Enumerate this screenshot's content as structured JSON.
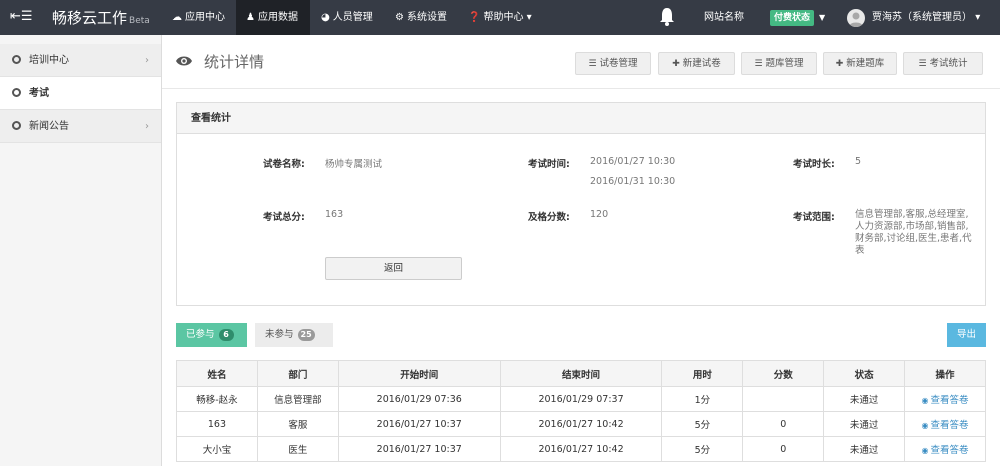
{
  "navbar": {
    "brand": "畅移云工作",
    "beta": "Beta",
    "items": [
      {
        "label": "应用中心",
        "icon": "cloud-icon"
      },
      {
        "label": "应用数据",
        "icon": "users-icon",
        "active": true
      },
      {
        "label": "人员管理",
        "icon": "dashboard-icon"
      },
      {
        "label": "系统设置",
        "icon": "gears-icon"
      },
      {
        "label": "帮助中心",
        "icon": "question-icon"
      }
    ],
    "site_name": "网站名称",
    "pay_status": "付费状态",
    "user": "贾海苏（系统管理员）",
    "accent": "#44b983"
  },
  "sidebar": {
    "items": [
      {
        "label": "培训中心"
      },
      {
        "label": "考试"
      },
      {
        "label": "新闻公告"
      }
    ]
  },
  "header": {
    "title": "统计详情",
    "buttons": [
      {
        "label": "试卷管理",
        "icon": "list-icon"
      },
      {
        "label": "新建试卷",
        "icon": "plus-icon"
      },
      {
        "label": "题库管理",
        "icon": "list-icon"
      },
      {
        "label": "新建题库",
        "icon": "plus-icon"
      },
      {
        "label": "考试统计",
        "icon": "list-icon"
      }
    ]
  },
  "panel": {
    "title": "查看统计",
    "paper_name_label": "试卷名称:",
    "paper_name": "杨帅专属测试",
    "exam_time_label": "考试时间:",
    "exam_time_start": "2016/01/27 10:30",
    "exam_time_end": "2016/01/31 10:30",
    "duration_label": "考试时长:",
    "duration": "5",
    "total_label": "考试总分:",
    "total": "163",
    "pass_label": "及格分数:",
    "pass": "120",
    "range_label": "考试范围:",
    "range": "信息管理部,客服,总经理室,人力资源部,市场部,销售部,财务部,讨论组,医生,患者,代表",
    "back_button": "返回"
  },
  "tabs": {
    "joined_label": "已参与",
    "joined_count": "6",
    "not_joined_label": "未参与",
    "not_joined_count": "25",
    "export": "导出"
  },
  "table": {
    "headers": [
      "姓名",
      "部门",
      "开始时间",
      "结束时间",
      "用时",
      "分数",
      "状态",
      "操作"
    ],
    "rows": [
      {
        "name": "畅移-赵永",
        "dept": "信息管理部",
        "start": "2016/01/29 07:36",
        "end": "2016/01/29 07:37",
        "used": "1分",
        "score": "",
        "status": "未通过",
        "action": "查看答卷"
      },
      {
        "name": "163",
        "dept": "客服",
        "start": "2016/01/27 10:37",
        "end": "2016/01/27 10:42",
        "used": "5分",
        "score": "0",
        "status": "未通过",
        "action": "查看答卷"
      },
      {
        "name": "大小宝",
        "dept": "医生",
        "start": "2016/01/27 10:37",
        "end": "2016/01/27 10:42",
        "used": "5分",
        "score": "0",
        "status": "未通过",
        "action": "查看答卷"
      }
    ]
  }
}
